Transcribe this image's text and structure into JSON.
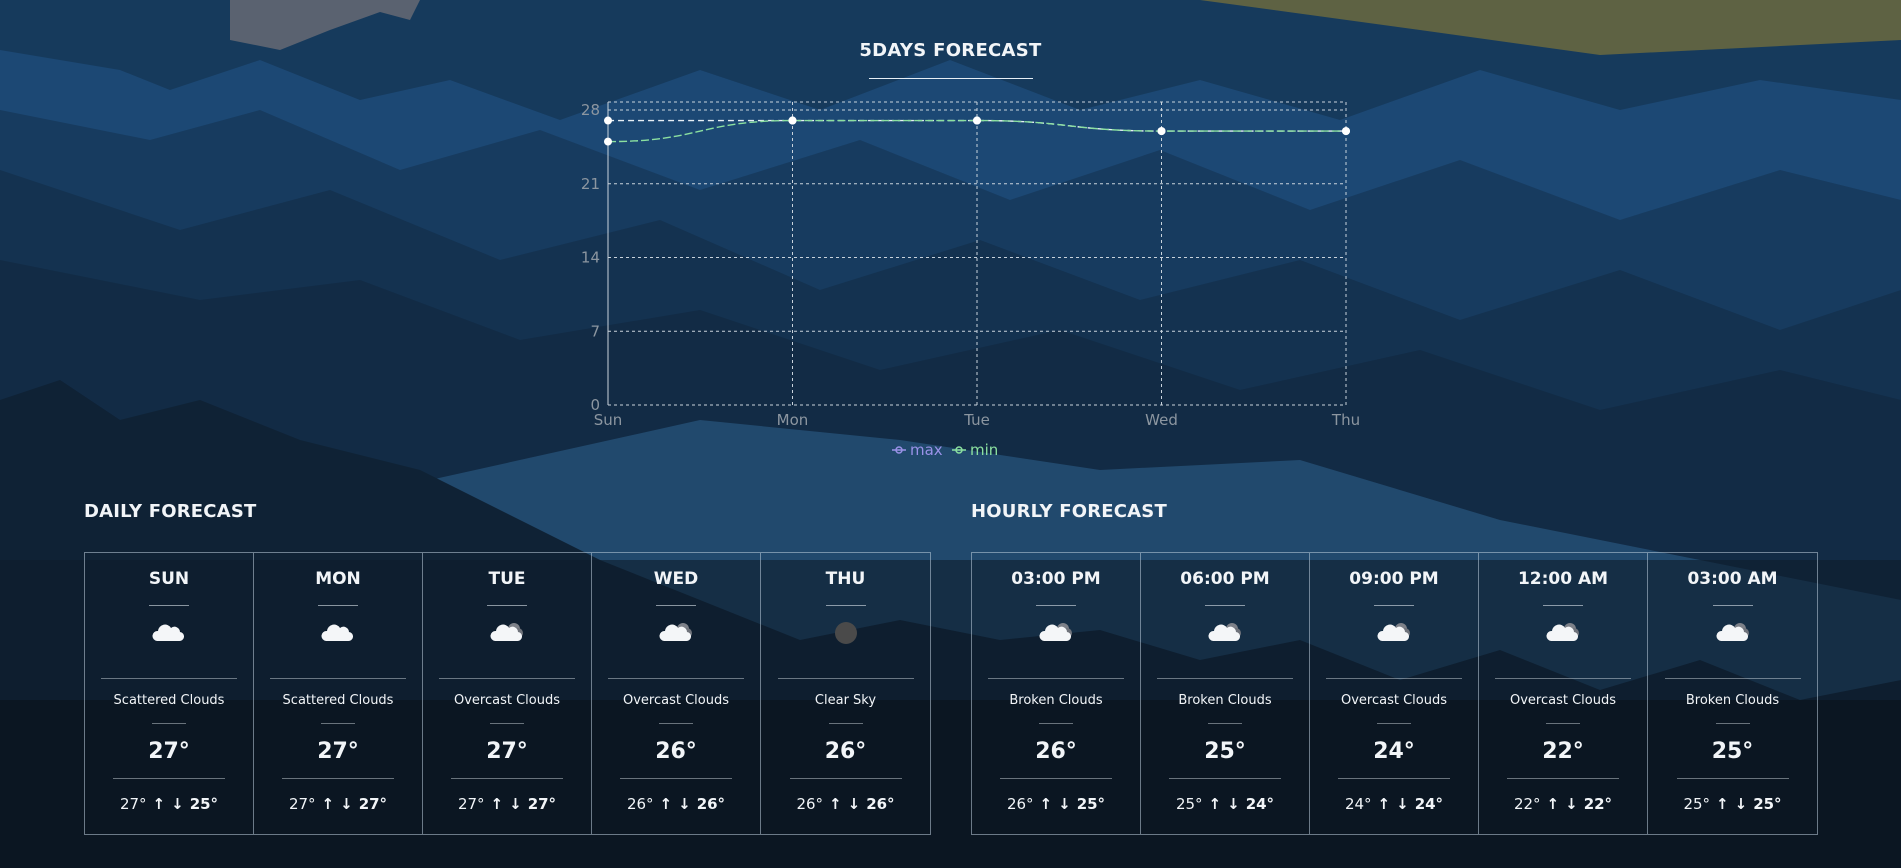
{
  "chart": {
    "title": "5DAYS FORECAST",
    "chart_data": {
      "type": "line",
      "categories": [
        "Sun",
        "Mon",
        "Tue",
        "Wed",
        "Thu"
      ],
      "series": [
        {
          "name": "max",
          "values": [
            27,
            27,
            27,
            26,
            26
          ],
          "color": "#e6eef5"
        },
        {
          "name": "min",
          "values": [
            25,
            27,
            27,
            26,
            26
          ],
          "color": "#8be0a0"
        }
      ],
      "y_ticks": [
        "0",
        "7",
        "14",
        "21",
        "28"
      ],
      "ylim": [
        0,
        28
      ],
      "grid": true,
      "legend_position": "bottom-center",
      "legend": [
        {
          "label": "max",
          "color": "#9a92e8"
        },
        {
          "label": "min",
          "color": "#8be0a0"
        }
      ]
    }
  },
  "daily": {
    "title": "DAILY FORECAST",
    "cards": [
      {
        "label": "SUN",
        "icon": "cloud-icon",
        "desc": "Scattered Clouds",
        "temp": "27°",
        "high": "27°",
        "low": "25°"
      },
      {
        "label": "MON",
        "icon": "cloud-icon",
        "desc": "Scattered Clouds",
        "temp": "27°",
        "high": "27°",
        "low": "27°"
      },
      {
        "label": "TUE",
        "icon": "overcast-clouds-icon",
        "desc": "Overcast Clouds",
        "temp": "27°",
        "high": "27°",
        "low": "27°"
      },
      {
        "label": "WED",
        "icon": "overcast-clouds-icon",
        "desc": "Overcast Clouds",
        "temp": "26°",
        "high": "26°",
        "low": "26°"
      },
      {
        "label": "THU",
        "icon": "clear-sky-icon",
        "desc": "Clear Sky",
        "temp": "26°",
        "high": "26°",
        "low": "26°"
      }
    ]
  },
  "hourly": {
    "title": "HOURLY FORECAST",
    "cards": [
      {
        "label": "03:00 PM",
        "icon": "broken-clouds-icon",
        "desc": "Broken Clouds",
        "temp": "26°",
        "high": "26°",
        "low": "25°"
      },
      {
        "label": "06:00 PM",
        "icon": "broken-clouds-icon",
        "desc": "Broken Clouds",
        "temp": "25°",
        "high": "25°",
        "low": "24°"
      },
      {
        "label": "09:00 PM",
        "icon": "overcast-clouds-icon",
        "desc": "Overcast Clouds",
        "temp": "24°",
        "high": "24°",
        "low": "24°"
      },
      {
        "label": "12:00 AM",
        "icon": "overcast-clouds-icon",
        "desc": "Overcast Clouds",
        "temp": "22°",
        "high": "22°",
        "low": "22°"
      },
      {
        "label": "03:00 AM",
        "icon": "broken-clouds-icon",
        "desc": "Broken Clouds",
        "temp": "25°",
        "high": "25°",
        "low": "25°"
      }
    ]
  },
  "arrows": {
    "up": "↑",
    "down": "↓"
  }
}
